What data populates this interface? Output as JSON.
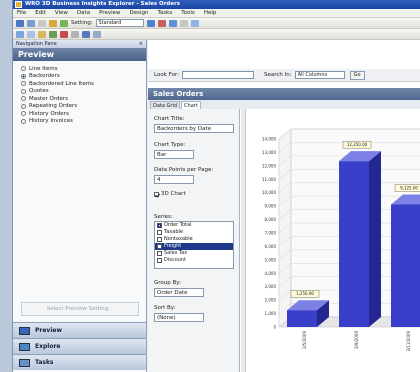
{
  "window": {
    "title": "WRO 3D Business Insights Explorer - Sales Orders"
  },
  "menu": [
    "File",
    "Edit",
    "View",
    "Data",
    "Preview",
    "Design",
    "Tasks",
    "Tools",
    "Help"
  ],
  "toolbar1": {
    "setting_label": "Setting:",
    "setting_value": "Standard"
  },
  "nav": {
    "header": "Navigation Pane",
    "close": "×",
    "title": "Preview",
    "items": [
      {
        "label": "Line Items",
        "selected": false
      },
      {
        "label": "Backorders",
        "selected": true
      },
      {
        "label": "Backordered Line Items",
        "selected": false
      },
      {
        "label": "Quotes",
        "selected": false
      },
      {
        "label": "Master Orders",
        "selected": false
      },
      {
        "label": "Repeating Orders",
        "selected": false
      },
      {
        "label": "History Orders",
        "selected": false
      },
      {
        "label": "History Invoices",
        "selected": false
      }
    ],
    "select_button": "Select Preview Setting...",
    "bottom": [
      "Preview",
      "Explore",
      "Tasks"
    ]
  },
  "lookbar": {
    "look_for_label": "Look For:",
    "search_in_label": "Search In:",
    "search_in_value": "All Columns",
    "go_label": "Go"
  },
  "panel": {
    "title": "Sales Orders",
    "tabs": [
      "Data Grid",
      "Chart"
    ]
  },
  "config": {
    "chart_title_label": "Chart Title:",
    "chart_title_value": "Backorders by Date",
    "chart_type_label": "Chart Type:",
    "chart_type_value": "Bar",
    "points_label": "Data Points per Page:",
    "points_value": "4",
    "threed_label": "3D Chart",
    "series_label": "Series:",
    "series": [
      {
        "label": "Order Total",
        "checked": true,
        "selected": false
      },
      {
        "label": "Taxable",
        "checked": false,
        "selected": false
      },
      {
        "label": "Nontaxable",
        "checked": false,
        "selected": false
      },
      {
        "label": "Freight",
        "checked": false,
        "selected": true
      },
      {
        "label": "Sales Tax",
        "checked": false,
        "selected": false
      },
      {
        "label": "Discount",
        "checked": false,
        "selected": false
      }
    ],
    "groupby_label": "Group By:",
    "groupby_value": "Order Date",
    "sortby_label": "Sort By:",
    "sortby_value": "(None)"
  },
  "chart_data": {
    "type": "bar",
    "three_d": true,
    "categories": [
      "3/5/2009",
      "3/9/2009",
      "3/11/2009"
    ],
    "values": [
      1250.0,
      12350.0,
      9125.0
    ],
    "data_labels": [
      "1,250.00",
      "12,350.00",
      "9,125.00"
    ],
    "y_ticks": [
      "0",
      "1,000",
      "2,000",
      "3,000",
      "4,000",
      "5,000",
      "6,000",
      "7,000",
      "8,000",
      "9,000",
      "10,000",
      "11,000",
      "12,000",
      "13,000",
      "14,000"
    ],
    "ylim": [
      0,
      14000
    ],
    "bar_color": "#3a3fc9"
  },
  "colors": {
    "titlebar": "#1a45a0",
    "panel_header": "#4f668e",
    "selection": "#1f3a8c"
  }
}
